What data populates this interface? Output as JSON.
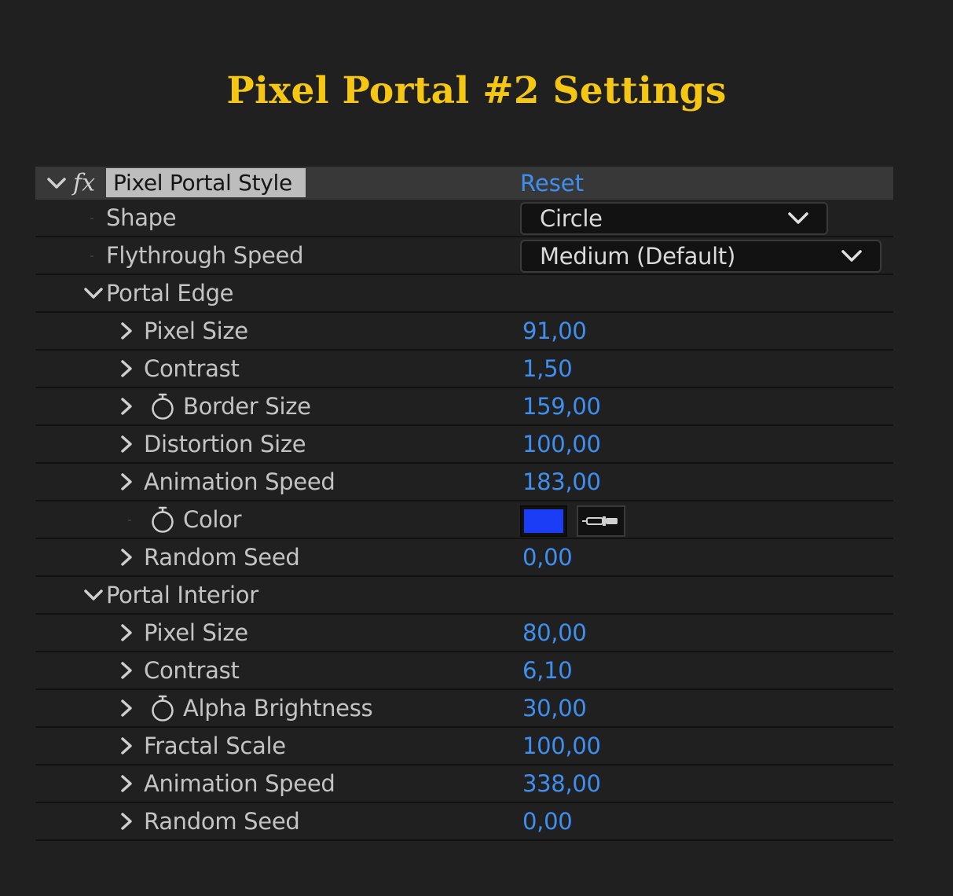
{
  "page_title": "Pixel Portal #2 Settings",
  "effect": {
    "fx_label": "fx",
    "name": "Pixel Portal Style",
    "reset_label": "Reset"
  },
  "shape": {
    "label": "Shape",
    "value": "Circle"
  },
  "flythrough": {
    "label": "Flythrough Speed",
    "value": "Medium (Default)"
  },
  "portal_edge": {
    "label": "Portal Edge",
    "pixel_size": {
      "label": "Pixel Size",
      "value": "91,00"
    },
    "contrast": {
      "label": "Contrast",
      "value": "1,50"
    },
    "border_size": {
      "label": "Border Size",
      "value": "159,00"
    },
    "distortion_size": {
      "label": "Distortion Size",
      "value": "100,00"
    },
    "animation_speed": {
      "label": "Animation Speed",
      "value": "183,00"
    },
    "color": {
      "label": "Color",
      "value": "#1a3df5"
    },
    "random_seed": {
      "label": "Random Seed",
      "value": "0,00"
    }
  },
  "portal_interior": {
    "label": "Portal Interior",
    "pixel_size": {
      "label": "Pixel Size",
      "value": "80,00"
    },
    "contrast": {
      "label": "Contrast",
      "value": "6,10"
    },
    "alpha_brightness": {
      "label": "Alpha Brightness",
      "value": "30,00"
    },
    "fractal_scale": {
      "label": "Fractal Scale",
      "value": "100,00"
    },
    "animation_speed": {
      "label": "Animation Speed",
      "value": "338,00"
    },
    "random_seed": {
      "label": "Random Seed",
      "value": "0,00"
    }
  },
  "colors": {
    "title": "#f5c612",
    "value_blue": "#3f8ff0",
    "background": "#202020",
    "header_bg": "#383838"
  },
  "icons": [
    "chevron-down-icon",
    "chevron-right-icon",
    "stopwatch-icon",
    "eyedropper-icon",
    "fx-icon"
  ]
}
